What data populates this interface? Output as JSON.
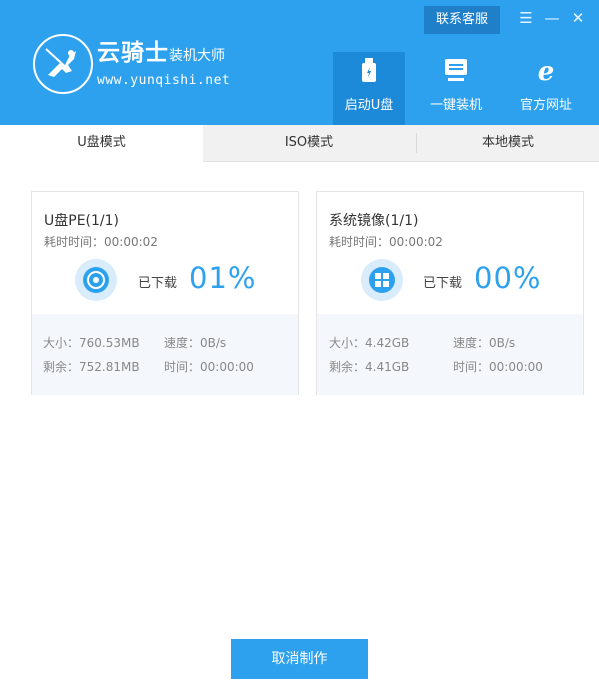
{
  "app": {
    "logo_main": "云骑士",
    "logo_sub": "装机大师",
    "logo_url": "www.yunqishi.net"
  },
  "header": {
    "contact_label": "联系客服",
    "nav": [
      {
        "label": "启动U盘",
        "icon": "usb-drive-icon",
        "active": true
      },
      {
        "label": "一键装机",
        "icon": "monitor-icon",
        "active": false
      },
      {
        "label": "官方网址",
        "icon": "ie-browser-icon",
        "active": false
      }
    ]
  },
  "tabs": [
    {
      "label": "U盘模式",
      "active": true
    },
    {
      "label": "ISO模式",
      "active": false
    },
    {
      "label": "本地模式",
      "active": false
    }
  ],
  "cards": [
    {
      "title": "U盘PE(1/1)",
      "elapsed": "耗时时间：00:00:02",
      "icon": "disc-icon",
      "downloaded_label": "已下载",
      "percent": "01%",
      "size": "大小：760.53MB",
      "remaining": "剩余：752.81MB",
      "speed": "速度：0B/s",
      "time": "时间：00:00:00"
    },
    {
      "title": "系统镜像(1/1)",
      "elapsed": "耗时时间：00:00:02",
      "icon": "windows-logo-icon",
      "downloaded_label": "已下载",
      "percent": "00%",
      "size": "大小：4.42GB",
      "remaining": "剩余：4.41GB",
      "speed": "速度：0B/s",
      "time": "时间：00:00:00"
    }
  ],
  "footer": {
    "cancel_label": "取消制作"
  },
  "colors": {
    "accent": "#2da1ee",
    "accent_dark": "#1f7fc9"
  }
}
